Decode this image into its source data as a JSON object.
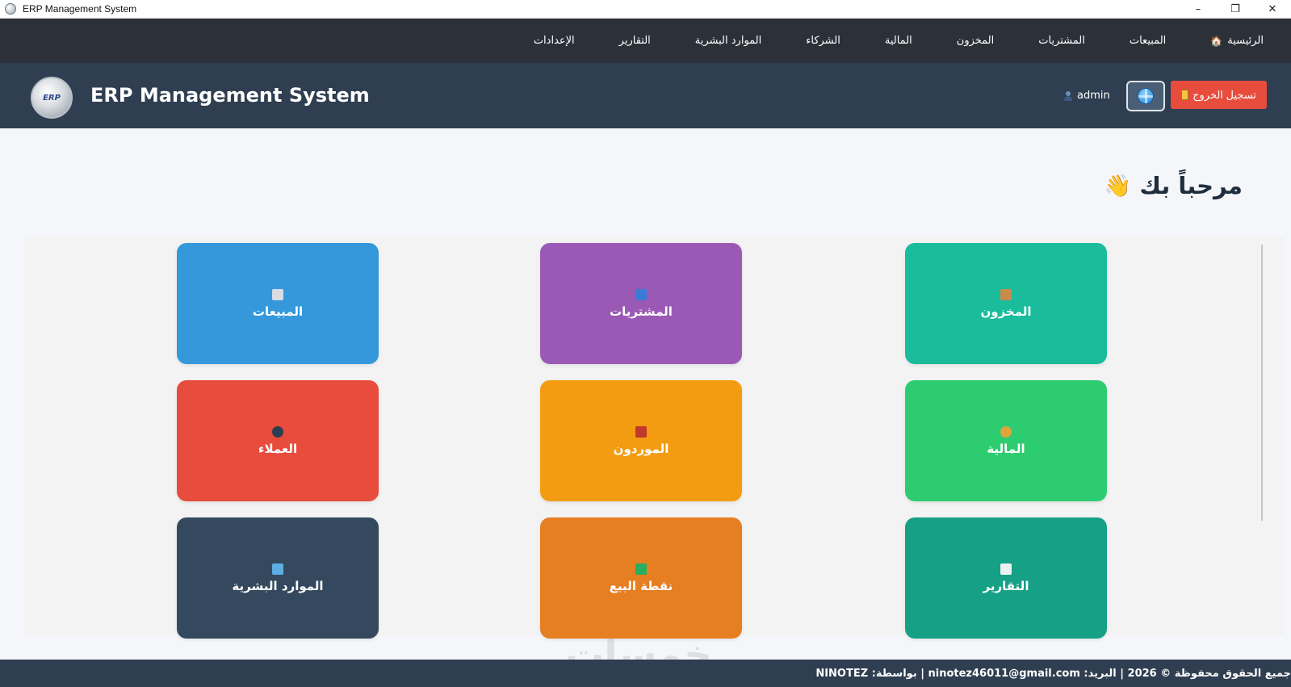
{
  "window": {
    "title": "ERP Management System",
    "controls": {
      "minimize": "–",
      "maximize": "❐",
      "close": "✕"
    }
  },
  "nav": {
    "items": [
      {
        "label": "الرئيسية",
        "icon": "home-icon"
      },
      {
        "label": "المبيعات"
      },
      {
        "label": "المشتريات"
      },
      {
        "label": "المخزون"
      },
      {
        "label": "المالية"
      },
      {
        "label": "الشركاء"
      },
      {
        "label": "الموارد البشرية"
      },
      {
        "label": "التقارير"
      },
      {
        "label": "الإعدادات"
      }
    ]
  },
  "header": {
    "brand": "ERP Management System",
    "logo_text": "ERP",
    "logout_label": "تسجيل الخروج",
    "username": "admin"
  },
  "welcome": {
    "text": "مرحباً بك",
    "emoji": "👋"
  },
  "modules": [
    {
      "label": "المخزون",
      "color": "#1abc9c",
      "icon": "box-icon"
    },
    {
      "label": "المشتريات",
      "color": "#9b59b6",
      "icon": "shopping-bags-icon"
    },
    {
      "label": "المبيعات",
      "color": "#3498db",
      "icon": "keyboard-icon"
    },
    {
      "label": "المالية",
      "color": "#2ecc71",
      "icon": "money-bag-icon"
    },
    {
      "label": "الموردون",
      "color": "#f39c12",
      "icon": "factory-icon"
    },
    {
      "label": "العملاء",
      "color": "#e74c3c",
      "icon": "users-icon"
    },
    {
      "label": "التقارير",
      "color": "#16a085",
      "icon": "chart-icon"
    },
    {
      "label": "نقطة البيع",
      "color": "#e67e22",
      "icon": "pos-icon"
    },
    {
      "label": "الموارد البشرية",
      "color": "#34495e",
      "icon": "person-icon"
    }
  ],
  "footer": {
    "text": "جميع الحقوق محفوظة © 2026 | البريد: ninotez46011@gmail.com | بواسطة: NINOTEZ"
  },
  "watermark": "خمسات"
}
